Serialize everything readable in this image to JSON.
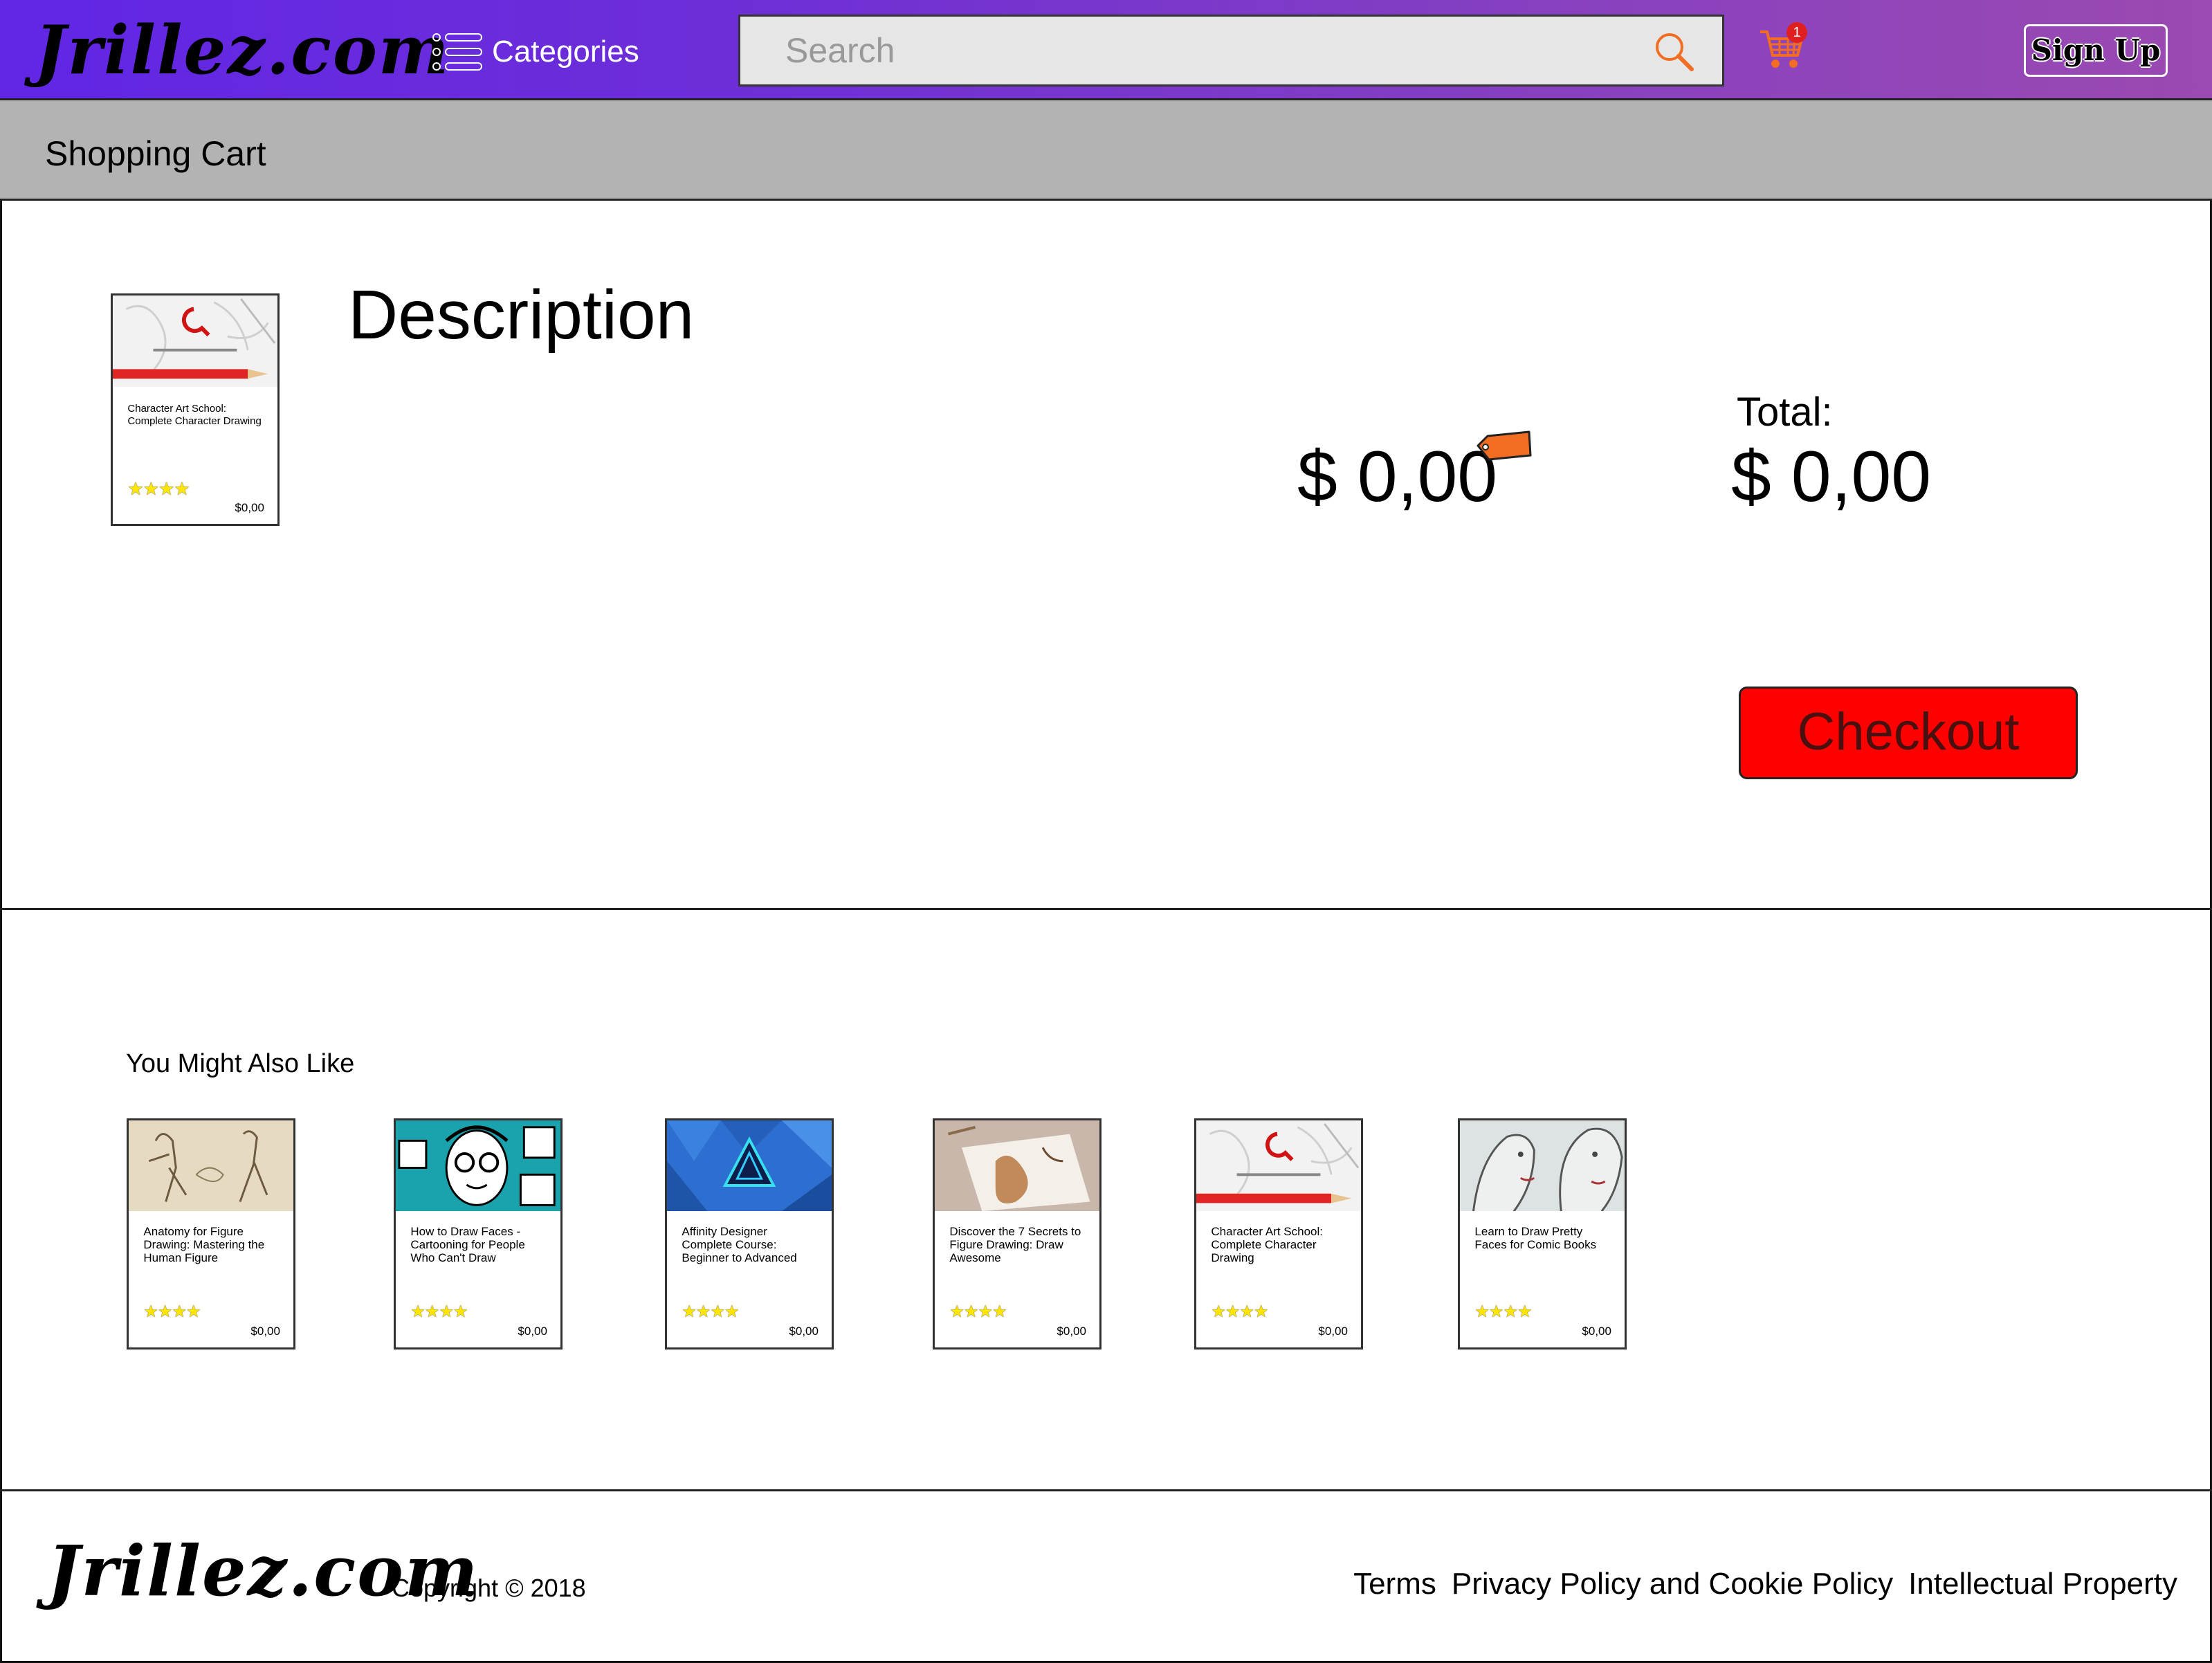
{
  "header": {
    "logo": "Jrillez.com",
    "categories_label": "Categories",
    "search_placeholder": "Search",
    "cart_count": "1",
    "signup_label": "Sign Up"
  },
  "page": {
    "title": "Shopping Cart"
  },
  "cart": {
    "item": {
      "title": "Character Art School: Complete Character Drawing",
      "price": "$0,00",
      "rating": "★★★★"
    },
    "description_heading": "Description",
    "item_price": "$ 0,00",
    "total_label": "Total:",
    "total_value": "$ 0,00",
    "checkout_label": "Checkout"
  },
  "recommendations": {
    "heading": "You Might Also Like",
    "items": [
      {
        "title": "Anatomy for Figure Drawing: Mastering the Human Figure",
        "price": "$0,00",
        "rating": "★★★★"
      },
      {
        "title": "How to Draw Faces - Cartooning for People Who Can't Draw",
        "price": "$0,00",
        "rating": "★★★★"
      },
      {
        "title": "Affinity Designer Complete Course: Beginner to Advanced",
        "price": "$0,00",
        "rating": "★★★★"
      },
      {
        "title": "Discover the 7 Secrets to Figure Drawing: Draw Awesome",
        "price": "$0,00",
        "rating": "★★★★"
      },
      {
        "title": "Character Art School: Complete Character Drawing",
        "price": "$0,00",
        "rating": "★★★★"
      },
      {
        "title": "Learn to Draw Pretty Faces for Comic Books",
        "price": "$0,00",
        "rating": "★★★★"
      }
    ]
  },
  "footer": {
    "logo": "Jrillez.com",
    "copyright": "Copyright © 2018",
    "links": [
      "Terms",
      "Privacy Policy and Cookie Policy",
      "Intellectual Property"
    ]
  },
  "colors": {
    "header_gradient_start": "#6126e6",
    "header_gradient_end": "#9a4ab0",
    "titlebar": "#b3b3b3",
    "checkout": "#ff0000",
    "accent_orange": "#f26d21",
    "badge": "#e02020",
    "star": "#ffe600"
  },
  "icons": {
    "categories": "list-icon",
    "search": "search-icon",
    "cart": "shopping-cart-icon",
    "price": "price-tag-icon",
    "rating": "star-icon"
  }
}
